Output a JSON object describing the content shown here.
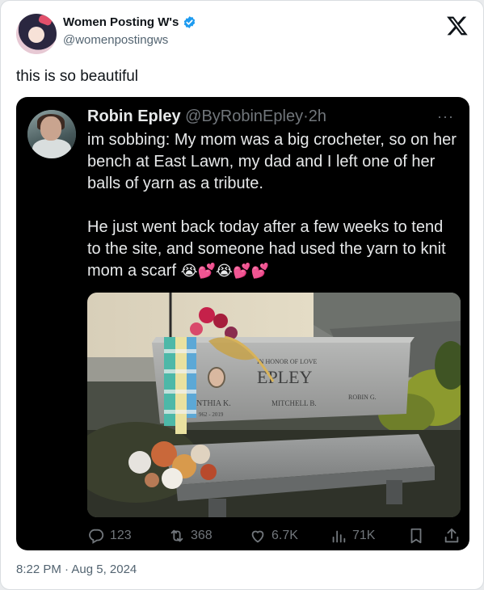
{
  "author": {
    "name": "Women Posting W's",
    "handle": "@womenpostingws"
  },
  "post": {
    "caption": "this is so beautiful",
    "timestamp": "8:22 PM · Aug 5, 2024"
  },
  "quoted": {
    "name": "Robin Epley",
    "handle": "@ByRobinEpley",
    "age": "2h",
    "more": "···",
    "paragraph1": "im sobbing: My mom was a big crocheter, so on her bench at East Lawn, my dad and I left one of her balls of yarn as a tribute.",
    "paragraph2": "He just went back today after a few weeks to tend to the site, and someone had used the yarn to knit mom a scarf",
    "emoji": "😭💕😭💕💕",
    "image": {
      "line1": "IN HONOR OF LOVE",
      "surname": "EPLEY",
      "name_left": "NTHIA K.",
      "years_left": "962 - 2019",
      "name_mid": "MITCHELL B.",
      "name_right": "ROBIN G."
    },
    "stats": {
      "replies": "123",
      "reposts": "368",
      "likes": "6.7K",
      "views": "71K"
    }
  },
  "colors": {
    "verified": "#1d9bf0",
    "quote_bg": "#000000",
    "muted": "#71767b"
  },
  "icons": [
    "verified-badge-icon",
    "x-logo-icon",
    "more-icon",
    "reply-icon",
    "repost-icon",
    "like-icon",
    "views-icon",
    "bookmark-icon",
    "share-icon"
  ]
}
